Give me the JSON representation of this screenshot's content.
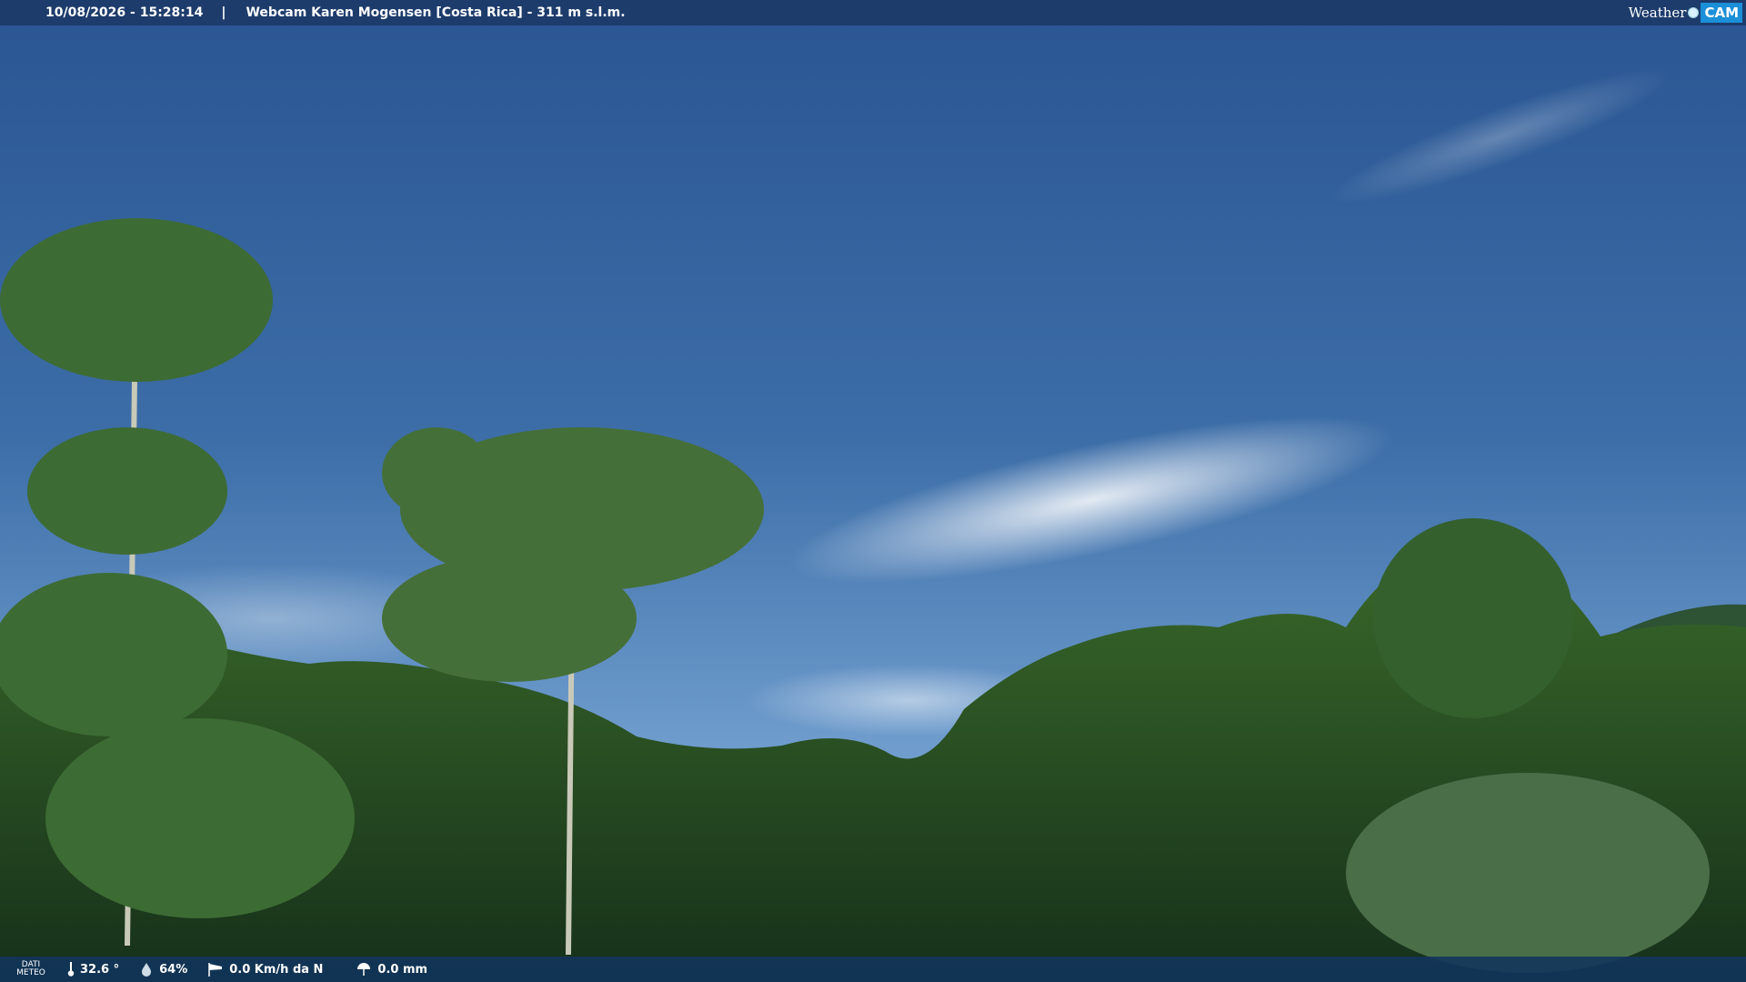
{
  "header": {
    "timestamp": "10/08/2026 - 15:28:14",
    "separator": "|",
    "title": "Webcam Karen Mogensen [Costa Rica]  - 311 m s.l.m."
  },
  "brand": {
    "weather": "Weather",
    "cam": "CAM"
  },
  "footer": {
    "dati_line1": "DATI",
    "dati_line2": "METEO",
    "temperature": "32.6 °",
    "humidity": "64%",
    "wind": "0.0 Km/h da N",
    "rain": "0.0 mm"
  },
  "icons": {
    "temperature": "thermometer-icon",
    "humidity": "droplet-icon",
    "wind": "windsock-icon",
    "rain": "rain-gauge-icon",
    "brand_lens": "camera-lens-icon"
  },
  "colors": {
    "bar": "#1c3a68",
    "brand_accent": "#1b8fd8",
    "sky": "#2f5f96"
  }
}
